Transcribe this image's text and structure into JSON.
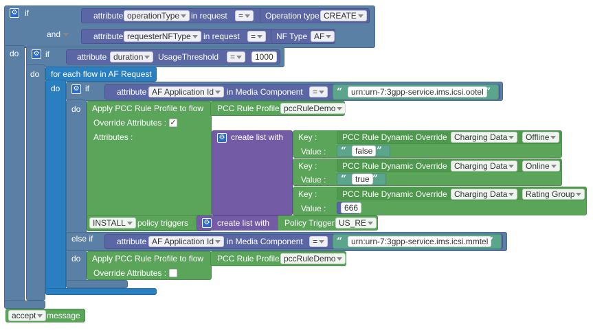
{
  "blocks": {
    "if_label": "if",
    "and_label": "and",
    "do_label": "do",
    "attribute_label": "attribute",
    "in_request_label": "in request",
    "operation_type_field": "operationType",
    "requester_field": "requesterNFType",
    "eq_op": "=",
    "operation_type_value_label": "Operation type",
    "operation_type_value": "CREATE",
    "nf_type_label": "NF Type",
    "nf_type_value": "AF",
    "duration_field": "duration",
    "usage_threshold": "UsageThreshold",
    "duration_value": "1000",
    "for_each": "for each flow in AF Request",
    "af_app_id": "AF Application Id",
    "in_media_component": "in Media Component",
    "urn_ootel": "urn:urn-7:3gpp-service.ims.icsi.ootel",
    "urn_mmtel": "urn:urn-7:3gpp-service.ims.icsi.mmtel",
    "apply_pcc": "Apply PCC Rule Profile to flow",
    "pcc_rule_profile": "PCC Rule Profile",
    "pcc_rule_demo": "pccRuleDemo",
    "override_attributes": "Override Attributes :",
    "attributes": "Attributes :",
    "create_list_with": "create list with",
    "key_label": "Key :",
    "value_label": "Value :",
    "dyn_override": "PCC Rule Dynamic Override",
    "charging_data": "Charging Data",
    "offline": "Offline",
    "online": "Online",
    "rating_group": "Rating Group",
    "false_val": "false",
    "true_val": "true",
    "num_666": "666",
    "install": "INSTALL",
    "policy_triggers": "policy triggers",
    "policy_trigger": "Policy Trigger",
    "us_re": "US_RE",
    "else_if": "else if",
    "accept": "accept",
    "message": "message",
    "check_mark": "✓",
    "quote_open": "“",
    "quote_close": "”",
    "gear_glyph": "⚙"
  }
}
